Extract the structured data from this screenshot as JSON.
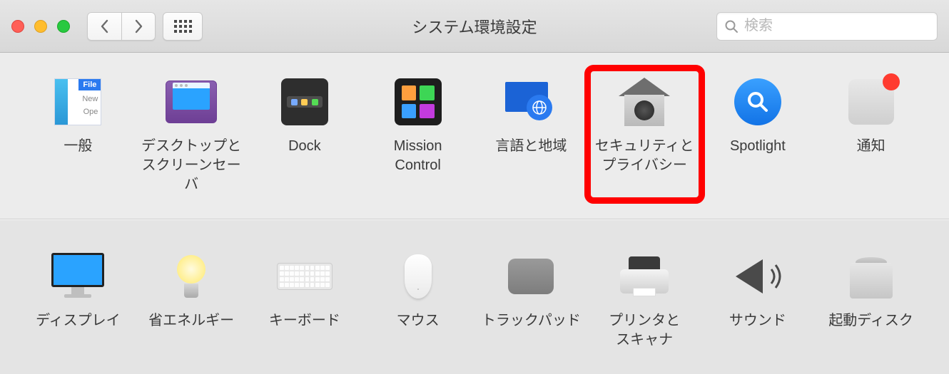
{
  "window": {
    "title": "システム環境設定",
    "search_placeholder": "検索"
  },
  "row1": [
    {
      "id": "general",
      "label": "一般"
    },
    {
      "id": "desktop",
      "label": "デスクトップと\nスクリーンセーバ"
    },
    {
      "id": "dock",
      "label": "Dock"
    },
    {
      "id": "mission",
      "label": "Mission\nControl"
    },
    {
      "id": "lang",
      "label": "言語と地域"
    },
    {
      "id": "security",
      "label": "セキュリティと\nプライバシー",
      "highlight": true
    },
    {
      "id": "spotlight",
      "label": "Spotlight"
    },
    {
      "id": "notif",
      "label": "通知"
    }
  ],
  "row2": [
    {
      "id": "display",
      "label": "ディスプレイ"
    },
    {
      "id": "energy",
      "label": "省エネルギー"
    },
    {
      "id": "keyboard",
      "label": "キーボード"
    },
    {
      "id": "mouse",
      "label": "マウス"
    },
    {
      "id": "trackpad",
      "label": "トラックパッド"
    },
    {
      "id": "printer",
      "label": "プリンタと\nスキャナ"
    },
    {
      "id": "sound",
      "label": "サウンド"
    },
    {
      "id": "startup",
      "label": "起動ディスク"
    }
  ]
}
